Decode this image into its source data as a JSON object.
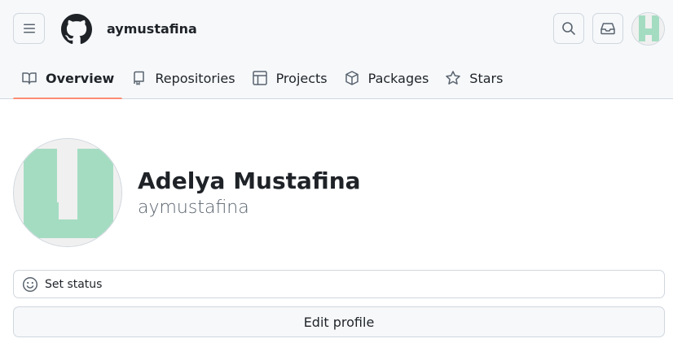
{
  "header": {
    "username": "aymustafina",
    "menu_icon": "hamburger-icon",
    "logo_icon": "github-logo-icon",
    "search_icon": "search-icon",
    "inbox_icon": "inbox-icon"
  },
  "tabs": [
    {
      "label": "Overview",
      "icon": "book-icon",
      "active": true
    },
    {
      "label": "Repositories",
      "icon": "repo-icon",
      "active": false
    },
    {
      "label": "Projects",
      "icon": "table-icon",
      "active": false
    },
    {
      "label": "Packages",
      "icon": "package-icon",
      "active": false
    },
    {
      "label": "Stars",
      "icon": "star-icon",
      "active": false
    }
  ],
  "profile": {
    "full_name": "Adelya Mustafina",
    "login": "aymustafina",
    "set_status_label": "Set status",
    "set_status_icon": "smiley-icon",
    "edit_profile_label": "Edit profile"
  },
  "colors": {
    "active_tab_underline": "#fd8c73",
    "avatar_mint": "#a4dcc2",
    "avatar_background": "#f0f0f0"
  }
}
